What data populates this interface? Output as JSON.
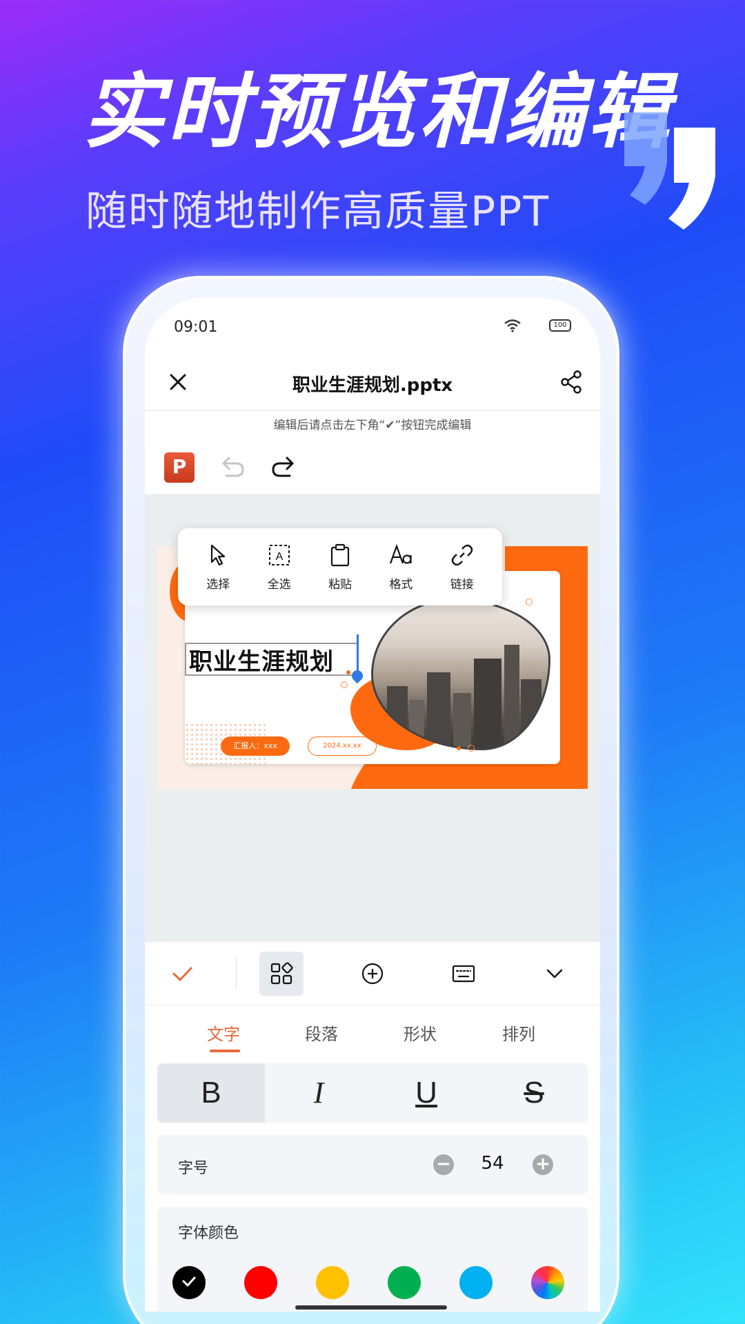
{
  "promo": {
    "headline": "实时预览和编辑",
    "subline": "随时随地制作高质量PPT"
  },
  "status_bar": {
    "time": "09:01",
    "battery": "100"
  },
  "app_bar": {
    "title": "职业生涯规划.pptx"
  },
  "hint": "编辑后请点击左下角“✔”按钮完成编辑",
  "toolbar": {
    "logo_letter": "P"
  },
  "slide": {
    "title": "职业生涯规划",
    "reporter": "汇报人：xxx",
    "date": "2024.xx.xx"
  },
  "context_menu": {
    "items": [
      {
        "label": "选择",
        "icon": "cursor-icon"
      },
      {
        "label": "全选",
        "icon": "select-all-icon"
      },
      {
        "label": "粘贴",
        "icon": "clipboard-icon"
      },
      {
        "label": "格式",
        "icon": "format-icon"
      },
      {
        "label": "链接",
        "icon": "link-icon"
      }
    ]
  },
  "format_tabs": [
    "文字",
    "段落",
    "形状",
    "排列"
  ],
  "active_tab": 0,
  "text_style": {
    "bold": "B",
    "italic": "I",
    "underline": "U",
    "strike": "S"
  },
  "font_size": {
    "label": "字号",
    "value": "54"
  },
  "font_color": {
    "label": "字体颜色",
    "swatches": [
      "#000000",
      "#ff0000",
      "#ffc000",
      "#00b050",
      "#00b0f0",
      "rainbow"
    ],
    "selected": 0
  },
  "colors": {
    "accent": "#e8683a",
    "slide_orange": "#ff6a10",
    "cursor_blue": "#2f7ae5"
  }
}
